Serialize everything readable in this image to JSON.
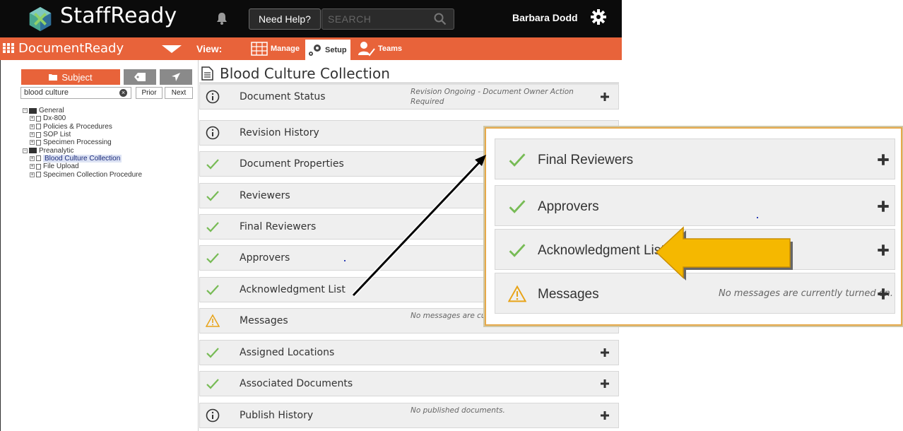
{
  "app": {
    "name": "StaffReady",
    "help_label": "Need Help?",
    "search_placeholder": "SEARCH",
    "user_name": "Barbara Dodd"
  },
  "module": {
    "name": "DocumentReady",
    "view_label": "View:",
    "views": [
      "Manage",
      "Setup",
      "Teams"
    ]
  },
  "left_panel": {
    "tab_subject": "Subject",
    "search_value": "blood culture",
    "prior_label": "Prior",
    "next_label": "Next",
    "tree": [
      {
        "label": "General",
        "type": "folder",
        "level": 0,
        "selected": false
      },
      {
        "label": "Dx-800",
        "type": "doc",
        "level": 1,
        "selected": false
      },
      {
        "label": "Policies & Procedures",
        "type": "doc",
        "level": 1,
        "selected": false
      },
      {
        "label": "SOP List",
        "type": "doc",
        "level": 1,
        "selected": false
      },
      {
        "label": "Specimen Processing",
        "type": "doc",
        "level": 1,
        "selected": false
      },
      {
        "label": "Preanalytic",
        "type": "folder",
        "level": 0,
        "selected": false
      },
      {
        "label": "Blood Culture Collection",
        "type": "doc",
        "level": 1,
        "selected": true
      },
      {
        "label": "File Upload",
        "type": "doc",
        "level": 1,
        "selected": false
      },
      {
        "label": "Specimen Collection Procedure",
        "type": "doc",
        "level": 1,
        "selected": false
      }
    ]
  },
  "document": {
    "title": "Blood Culture Collection",
    "sections": [
      {
        "label": "Document Status",
        "icon": "info-icon",
        "status": "Revision Ongoing - Document Owner Action Required"
      },
      {
        "label": "Revision History",
        "icon": "info-icon",
        "status": ""
      },
      {
        "label": "Document Properties",
        "icon": "check-icon",
        "status": ""
      },
      {
        "label": "Reviewers",
        "icon": "check-icon",
        "status": ""
      },
      {
        "label": "Final Reviewers",
        "icon": "check-icon",
        "status": ""
      },
      {
        "label": "Approvers",
        "icon": "check-icon",
        "status": ""
      },
      {
        "label": "Acknowledgment List",
        "icon": "check-icon",
        "status": ""
      },
      {
        "label": "Messages",
        "icon": "warning-icon",
        "status": "No messages are cu"
      },
      {
        "label": "Assigned Locations",
        "icon": "check-icon",
        "status": ""
      },
      {
        "label": "Associated Documents",
        "icon": "check-icon",
        "status": ""
      },
      {
        "label": "Publish History",
        "icon": "info-icon",
        "status": "No published documents."
      }
    ]
  },
  "zoom": {
    "sections": [
      {
        "label": "Final Reviewers",
        "icon": "check-icon",
        "status": ""
      },
      {
        "label": "Approvers",
        "icon": "check-icon",
        "status": ""
      },
      {
        "label": "Acknowledgment List",
        "icon": "check-icon",
        "status": ""
      },
      {
        "label": "Messages",
        "icon": "warning-icon",
        "status": "No messages are currently turned on."
      }
    ]
  },
  "colors": {
    "topbar": "#0b0b0b",
    "accent": "#e8633a",
    "check": "#77bb55",
    "warning": "#e8a317",
    "callout_arrow": "#f5b800"
  }
}
